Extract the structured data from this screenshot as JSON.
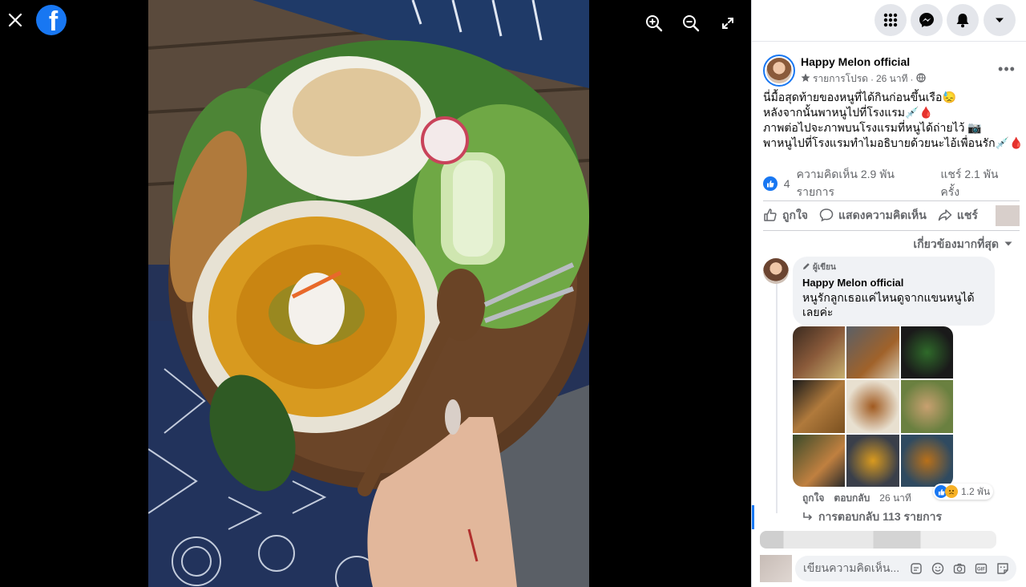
{
  "viewer": {
    "close_icon": "close-icon",
    "logo_glyph": "f",
    "tools": [
      "zoom-in-icon",
      "zoom-out-icon",
      "fullscreen-icon"
    ]
  },
  "header": {
    "buttons": [
      "menu-grid-icon",
      "messenger-icon",
      "notifications-bell-icon",
      "account-caret-icon"
    ]
  },
  "post": {
    "author": "Happy Melon official",
    "meta_label": "รายการโปรด",
    "meta_time": "26 นาที",
    "text_lines": [
      "นี่มื้อสุดท้ายของหนูที่ได้กินก่อนขึ้นเรือ😓",
      "หลังจากนั้นพาหนูไปที่โรงแรม💉🩸",
      "ภาพต่อไปจะภาพบนโรงแรมที่หนูได้ถ่ายไว้ 📷",
      "พาหนูไปที่โรงแรมทำไมอธิบายด้วยนะไอ้เพื่อนรัก💉🩸"
    ],
    "reactions_count": "4",
    "comments_count": "ความคิดเห็น 2.9 พัน รายการ",
    "shares_count": "แชร์ 2.1 พัน ครั้ง",
    "actions": {
      "like": "ถูกใจ",
      "comment": "แสดงความคิดเห็น",
      "share": "แชร์"
    },
    "sort_label": "เกี่ยวข้องมากที่สุด"
  },
  "comment": {
    "author_tag": "ผู้เขียน",
    "author": "Happy Melon official",
    "text": "หนูรักลูกเธอแค่ไหนดูจากแขนหนูได้เลยค่ะ",
    "like_label": "ถูกใจ",
    "reply_label": "ตอบกลับ",
    "time": "26 นาที",
    "reaction_count": "1.2 พัน",
    "replies_label": "การตอบกลับ 113 รายการ"
  },
  "composer": {
    "placeholder": "เขียนความคิดเห็น...",
    "icons": [
      "sticker-icon",
      "emoji-icon",
      "camera-icon",
      "gif-icon",
      "sticker-face-icon"
    ]
  },
  "colors": {
    "accent": "#1877f2",
    "panel_bg": "#ffffff",
    "bubble_bg": "#f0f2f5",
    "muted_text": "#65676b"
  }
}
